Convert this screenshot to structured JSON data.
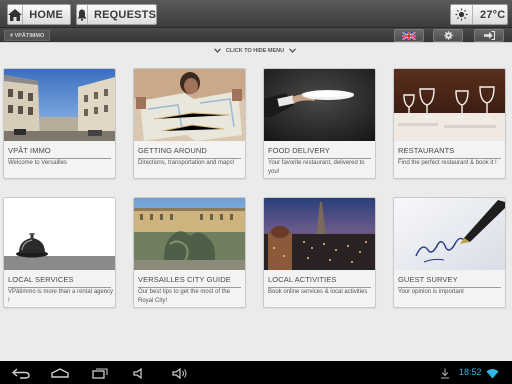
{
  "toolbar": {
    "home_label": "HOME",
    "requests_label": "REQUESTS",
    "temperature": "27°C",
    "home_icon": "home-icon",
    "requests_icon": "bell-icon",
    "weather_icon": "sun-icon"
  },
  "subbar": {
    "breadcrumb": "# VPÂTIMMO",
    "language_icon": "uk-flag-icon",
    "settings_icon": "gear-icon",
    "logout_icon": "logout-icon"
  },
  "menu_toggle": {
    "label": "CLICK TO HIDE MENU"
  },
  "cards": [
    {
      "title": "VPÂT IMMO",
      "description": "Welcome to Versailles"
    },
    {
      "title": "GETTING AROUND",
      "description": "Directions, transportation and maps!"
    },
    {
      "title": "FOOD DELIVERY",
      "description": "Your favorite restaurant, delivered to you!"
    },
    {
      "title": "RESTAURANTS",
      "description": "Find the perfect restaurant & book it !"
    },
    {
      "title": "LOCAL SERVICES",
      "description": "VPâtimmo is more than a rental agency !"
    },
    {
      "title": "VERSAILLES CITY GUIDE",
      "description": "Our best tips to get the most of the Royal City!"
    },
    {
      "title": "LOCAL ACTIVITIES",
      "description": "Book online services & local activities"
    },
    {
      "title": "GUEST SURVEY",
      "description": "Your opinion is important"
    }
  ],
  "system_bar": {
    "time": "18:52",
    "icons": [
      "back-icon",
      "home-nav-icon",
      "recent-apps-icon",
      "volume-down-icon",
      "volume-up-icon",
      "download-icon",
      "wifi-icon"
    ]
  },
  "colors": {
    "accent_clock": "#33b5e5",
    "toolbar_dark": "#3c3c3c",
    "page_bg": "#ebebeb"
  }
}
